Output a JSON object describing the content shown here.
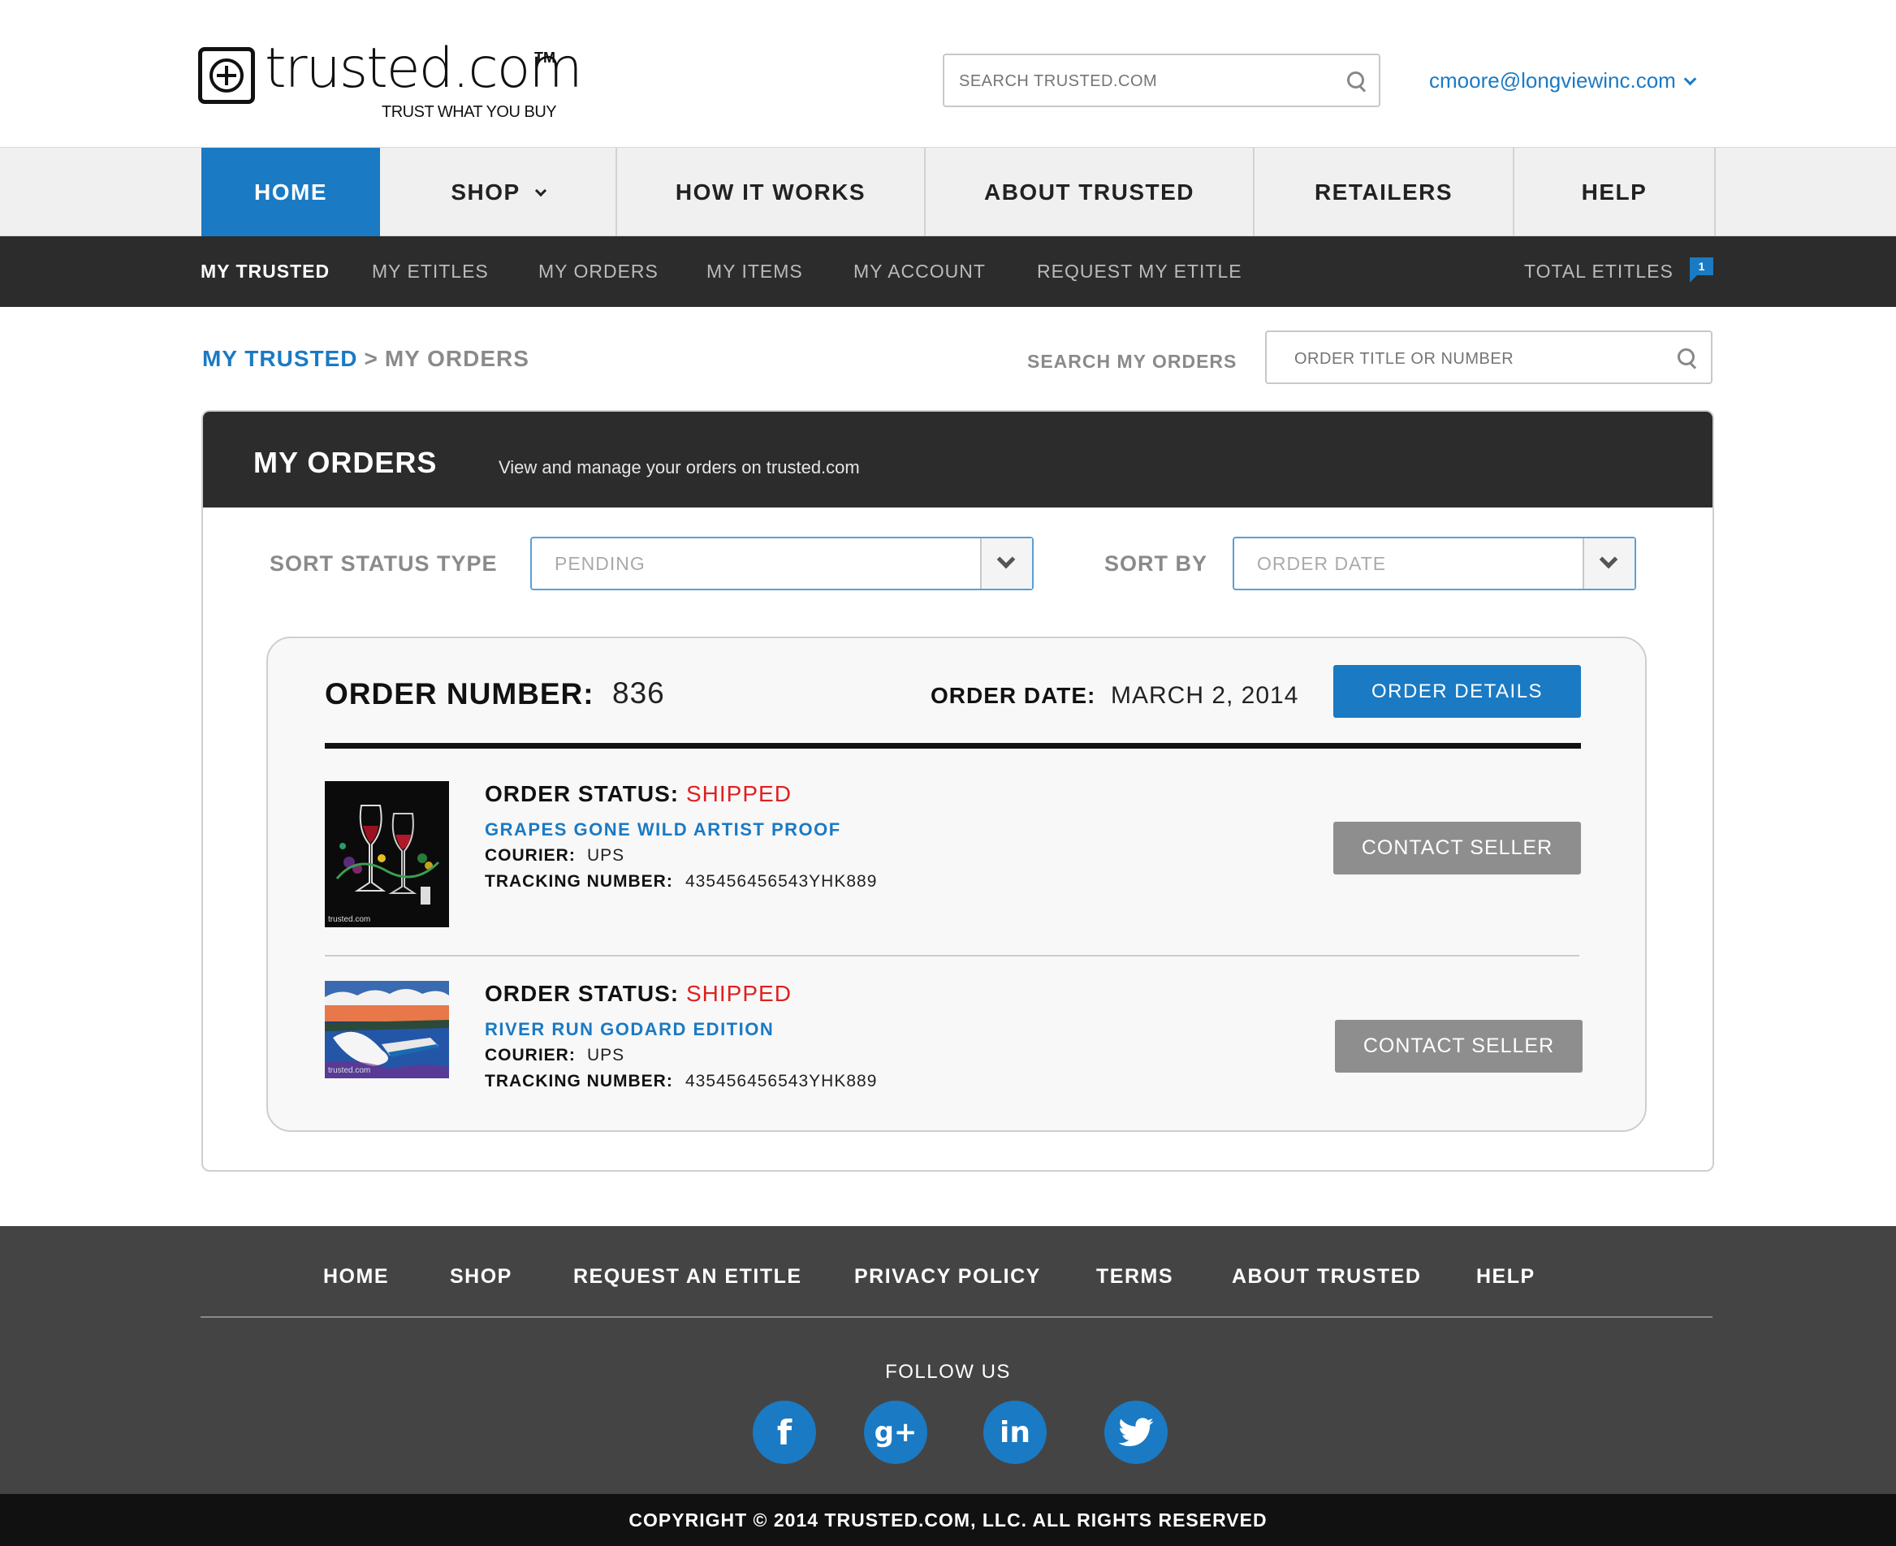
{
  "header": {
    "logo_word": "trusted.com",
    "logo_tm": "TM",
    "logo_tagline": "TRUST WHAT YOU BUY",
    "search_placeholder": "SEARCH TRUSTED.COM",
    "user_email": "cmoore@longviewinc.com"
  },
  "main_nav": {
    "items": [
      {
        "label": "HOME",
        "active": true
      },
      {
        "label": "SHOP",
        "has_dropdown": true
      },
      {
        "label": "HOW IT WORKS"
      },
      {
        "label": "ABOUT TRUSTED"
      },
      {
        "label": "RETAILERS"
      },
      {
        "label": "HELP"
      }
    ]
  },
  "sub_nav": {
    "items": [
      {
        "label": "MY TRUSTED",
        "active": true
      },
      {
        "label": "MY ETITLES"
      },
      {
        "label": "MY ORDERS"
      },
      {
        "label": "MY ITEMS"
      },
      {
        "label": "MY ACCOUNT"
      },
      {
        "label": "REQUEST MY ETITLE"
      }
    ],
    "total_label": "TOTAL ETITLES",
    "total_count": "1"
  },
  "breadcrumb": {
    "root": "MY TRUSTED",
    "separator": ">",
    "current": "MY ORDERS"
  },
  "order_search": {
    "label": "SEARCH MY ORDERS",
    "placeholder": "ORDER TITLE OR NUMBER"
  },
  "panel": {
    "title": "MY ORDERS",
    "subtitle": "View and manage your orders on trusted.com",
    "sort_status_label": "SORT STATUS TYPE",
    "sort_status_value": "PENDING",
    "sort_by_label": "SORT BY",
    "sort_by_value": "ORDER DATE"
  },
  "order": {
    "number_label": "ORDER NUMBER:",
    "number": "836",
    "date_label": "ORDER DATE:",
    "date": "MARCH 2, 2014",
    "details_button": "ORDER DETAILS",
    "items": [
      {
        "status_label": "ORDER STATUS:",
        "status": "SHIPPED",
        "title": "GRAPES GONE WILD ARTIST PROOF",
        "courier_label": "COURIER:",
        "courier": "UPS",
        "tracking_label": "TRACKING NUMBER:",
        "tracking": "435456456543YHK889",
        "contact_button": "CONTACT SELLER",
        "thumb_caption": "trusted.com"
      },
      {
        "status_label": "ORDER STATUS:",
        "status": "SHIPPED",
        "title": "RIVER RUN GODARD EDITION",
        "courier_label": "COURIER:",
        "courier": "UPS",
        "tracking_label": "TRACKING NUMBER:",
        "tracking": "435456456543YHK889",
        "contact_button": "CONTACT SELLER",
        "thumb_caption": "trusted.com"
      }
    ]
  },
  "footer": {
    "links": [
      "HOME",
      "SHOP",
      "REQUEST AN ETITLE",
      "PRIVACY POLICY",
      "TERMS",
      "ABOUT TRUSTED",
      "HELP"
    ],
    "follow_label": "FOLLOW US",
    "social": [
      {
        "icon": "facebook-icon",
        "glyph": "f"
      },
      {
        "icon": "google-plus-icon",
        "glyph": "g+"
      },
      {
        "icon": "linkedin-icon",
        "glyph": "in"
      },
      {
        "icon": "twitter-icon",
        "glyph": "t"
      }
    ],
    "copyright": "COPYRIGHT © 2014 TRUSTED.COM, LLC. ALL RIGHTS RESERVED"
  },
  "colors": {
    "accent": "#1a7ac4",
    "status_shipped": "#e02020",
    "dark_bar": "#2c2c2c",
    "footer_bg": "#444444",
    "button_gray": "#8e8e8e"
  }
}
